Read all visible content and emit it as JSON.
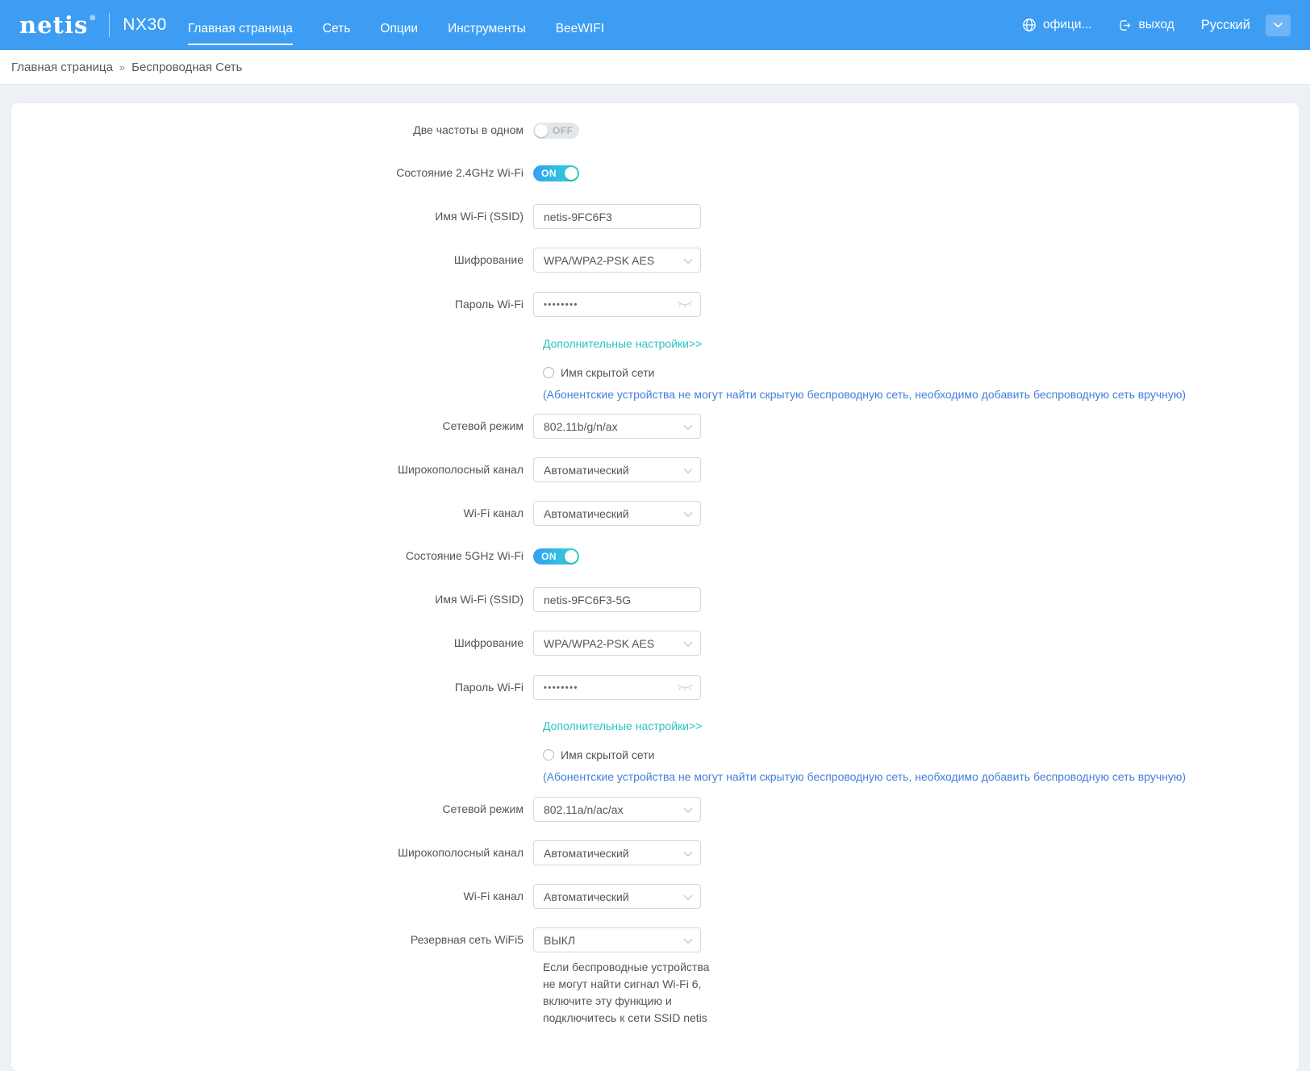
{
  "header": {
    "logo_text": "netis",
    "logo_reg": "®",
    "model": "NX30",
    "nav": [
      {
        "label": "Главная страница",
        "active": true
      },
      {
        "label": "Сеть",
        "active": false
      },
      {
        "label": "Опции",
        "active": false
      },
      {
        "label": "Инструменты",
        "active": false
      },
      {
        "label": "BeeWIFI",
        "active": false
      }
    ],
    "site_link": "офици...",
    "logout_label": "выход",
    "language": "Русский"
  },
  "breadcrumb": {
    "home": "Главная страница",
    "separator": "»",
    "current": "Беспроводная Сеть"
  },
  "form": {
    "dual_band_label": "Две частоты в одном",
    "dual_band_state": "OFF",
    "wifi24": {
      "status_label": "Состояние 2.4GHz Wi-Fi",
      "status_state": "ON",
      "ssid_label": "Имя Wi-Fi (SSID)",
      "ssid": "netis-9FC6F3",
      "encryption_label": "Шифрование",
      "encryption": "WPA/WPA2-PSK AES",
      "password_label": "Пароль Wi-Fi",
      "password_mask": "••••••••",
      "advanced_link": "Дополнительные настройки>>",
      "hidden_label": "Имя скрытой сети",
      "hidden_note": "(Абонентские устройства не могут найти скрытую беспроводную сеть, необходимо добавить беспроводную сеть вручную)",
      "mode_label": "Сетевой режим",
      "mode": "802.11b/g/n/ax",
      "bandwidth_label": "Широкополосный канал",
      "bandwidth": "Автоматический",
      "channel_label": "Wi-Fi канал",
      "channel": "Автоматический"
    },
    "wifi5": {
      "status_label": "Состояние 5GHz Wi-Fi",
      "status_state": "ON",
      "ssid_label": "Имя Wi-Fi (SSID)",
      "ssid": "netis-9FC6F3-5G",
      "encryption_label": "Шифрование",
      "encryption": "WPA/WPA2-PSK AES",
      "password_label": "Пароль Wi-Fi",
      "password_mask": "••••••••",
      "advanced_link": "Дополнительные настройки>>",
      "hidden_label": "Имя скрытой сети",
      "hidden_note": "(Абонентские устройства не могут найти скрытую беспроводную сеть, необходимо добавить беспроводную сеть вручную)",
      "mode_label": "Сетевой режим",
      "mode": "802.11a/n/ac/ax",
      "bandwidth_label": "Широкополосный канал",
      "bandwidth": "Автоматический",
      "channel_label": "Wi-Fi канал",
      "channel": "Автоматический"
    },
    "backup_label": "Резервная сеть WiFi5",
    "backup_value": "ВЫКЛ",
    "backup_help": "Если беспроводные устройства не могут найти сигнал Wi-Fi 6, включите эту функцию и подключитесь к сети SSID netis"
  },
  "colors": {
    "header_blue": "#3C9DF3",
    "toggle_on_start": "#33A0F4",
    "toggle_on_end": "#30D6D2",
    "link_teal": "#28C3C6",
    "note_blue": "#4180DC",
    "page_bg": "#EDF0F4"
  }
}
